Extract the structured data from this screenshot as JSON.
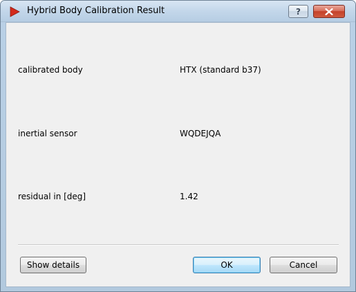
{
  "window": {
    "title": "Hybrid Body Calibration Result",
    "help_symbol": "?",
    "close_symbol": "✕"
  },
  "results": [
    {
      "label": "calibrated body",
      "value": "HTX (standard b37)"
    },
    {
      "label": "inertial sensor",
      "value": "WQDEJQA"
    },
    {
      "label": "residual in [deg]",
      "value": "1.42"
    }
  ],
  "buttons": {
    "details_label": "Show details",
    "ok_label": "OK",
    "cancel_label": "Cancel"
  },
  "colors": {
    "app_icon": "#d42a1c",
    "default_button_border": "#3c7fb1",
    "close_button": "#c4412a"
  }
}
